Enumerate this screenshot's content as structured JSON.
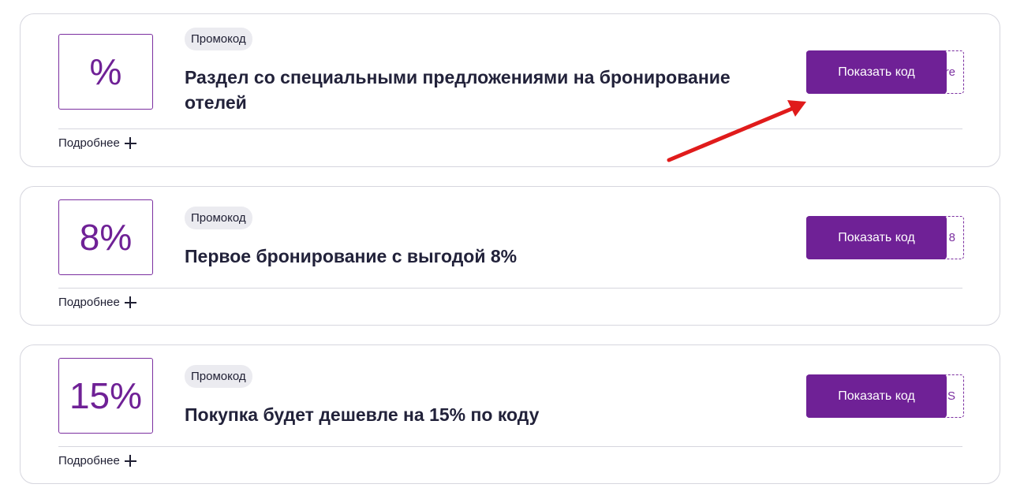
{
  "offers": [
    {
      "discount": "%",
      "badge": "Промокод",
      "title": "Раздел со специальными предложениями на бронирование отелей",
      "button_label": "Показать код",
      "code_hint": "re",
      "more_label": "Подробнее"
    },
    {
      "discount": "8%",
      "badge": "Промокод",
      "title": "Первое бронирование с выгодой 8%",
      "button_label": "Показать код",
      "code_hint": "8",
      "more_label": "Подробнее"
    },
    {
      "discount": "15%",
      "badge": "Промокод",
      "title": "Покупка будет дешевле на 15% по коду",
      "button_label": "Показать код",
      "code_hint": "S",
      "more_label": "Подробнее"
    }
  ],
  "colors": {
    "accent": "#6f2196",
    "annotation_arrow": "#e01b1b",
    "border": "#d6d6de",
    "badge_bg": "#ebebf0"
  },
  "icons": {
    "more": "plus-icon",
    "annotation": "red-arrow-icon"
  }
}
